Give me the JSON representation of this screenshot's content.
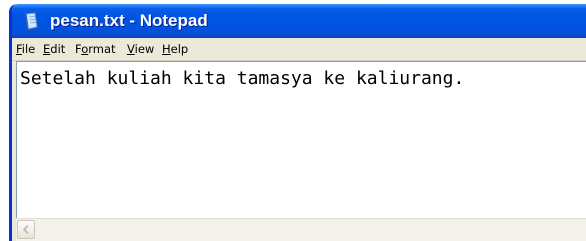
{
  "window": {
    "title": "pesan.txt - Notepad",
    "icon": "notepad-icon"
  },
  "menu": {
    "file": {
      "acc": "F",
      "rest": "ile"
    },
    "edit": {
      "acc": "E",
      "rest": "dit"
    },
    "format": {
      "pre": "F",
      "acc": "o",
      "rest": "rmat"
    },
    "view": {
      "acc": "V",
      "rest": "iew"
    },
    "help": {
      "acc": "H",
      "rest": "elp"
    }
  },
  "editor": {
    "content": "Setelah kuliah kita tamasya ke kaliurang."
  },
  "scrollbar": {
    "left_arrow_icon": "chevron-left-icon"
  },
  "colors": {
    "titlebar": "#0054e3",
    "title_text": "#ffffff",
    "menubar": "#ece9d8",
    "editor_bg": "#ffffff"
  }
}
